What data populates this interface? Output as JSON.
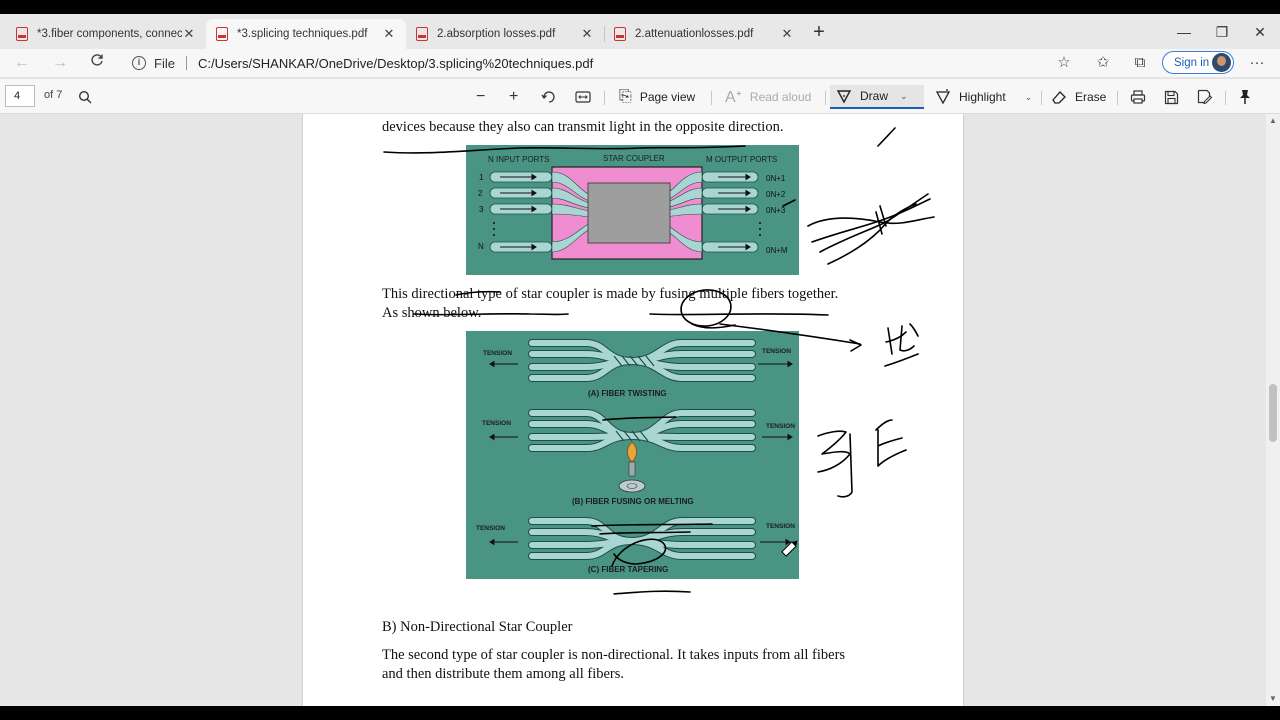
{
  "tabs": [
    {
      "label": "*3.fiber components, connectors",
      "active": false
    },
    {
      "label": "*3.splicing techniques.pdf",
      "active": true
    },
    {
      "label": "2.absorption losses.pdf",
      "active": false
    },
    {
      "label": "2.attenuationlosses.pdf",
      "active": false
    }
  ],
  "window": {
    "minimize": "—",
    "restore": "❐",
    "close": "✕",
    "new_tab": "+"
  },
  "address": {
    "file_label": "File",
    "url": "C:/Users/SHANKAR/OneDrive/Desktop/3.splicing%20techniques.pdf",
    "sign_in": "Sign in"
  },
  "pdf_toolbar": {
    "page_number": "4",
    "page_total": "of 7",
    "page_view": "Page view",
    "read_aloud": "Read aloud",
    "draw": "Draw",
    "highlight": "Highlight",
    "erase": "Erase"
  },
  "document": {
    "line1": "devices because they also can transmit light in the opposite direction.",
    "para1_line1": "This directional type of star coupler is made by fusing multiple fibers together.",
    "para1_line2": "As shown below.",
    "heading_b": "B) Non-Directional Star Coupler",
    "para2_line1": "The second type of star coupler is non-directional. It takes inputs from all fibers",
    "para2_line2": "and then distribute them among all fibers."
  },
  "figure1": {
    "input_ports": "N INPUT PORTS",
    "coupler": "STAR COUPLER",
    "output_ports": "M OUTPUT PORTS",
    "in_labels": [
      "1",
      "2",
      "3",
      "N"
    ],
    "out_labels": [
      "0N+1",
      "0N+2",
      "0N+3",
      "0N+M"
    ]
  },
  "figure2": {
    "tension": "TENSION",
    "caption_a": "(A) FIBER TWISTING",
    "caption_b": "(B) FIBER FUSING OR MELTING",
    "caption_c": "(C) FIBER TAPERING"
  },
  "colors": {
    "figure_bg": "#4a9484",
    "coupler_pink": "#f08cd0",
    "fiber": "#a9d6d2",
    "accent": "#1a5fb4"
  }
}
